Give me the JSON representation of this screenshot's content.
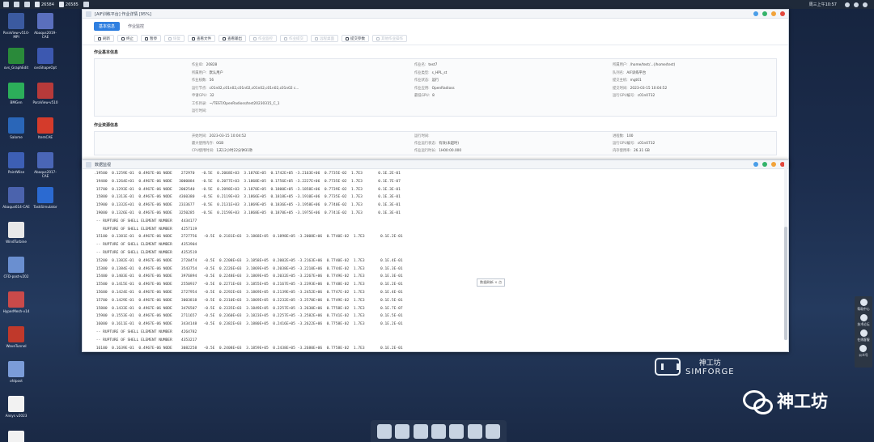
{
  "topbar": {
    "items": [
      {
        "label": "26584"
      },
      {
        "label": "26585"
      }
    ],
    "clock": "周三上午10:57"
  },
  "desktop_icons": [
    {
      "label": "ParaView-v510-MPI",
      "color": "#3b5aa0"
    },
    {
      "label": "Abaqus2019-CAE",
      "color": "#5a6fbd"
    },
    {
      "label": "ovs_GraphEdit",
      "color": "#2a8a3a"
    },
    {
      "label": "ovsShapeOpt",
      "color": "#3c58b0"
    },
    {
      "label": "BMGen",
      "color": "#2cae5a"
    },
    {
      "label": "ParaView-v510",
      "color": "#b73a3a"
    },
    {
      "label": "Salome",
      "color": "#2a66b8"
    },
    {
      "label": "ItemCAE",
      "color": "#d43b2b"
    },
    {
      "label": "PointWise",
      "color": "#3d5fb4"
    },
    {
      "label": "Abaqus2017-CAE",
      "color": "#4a66b6"
    },
    {
      "label": "Abaqus614-CAE",
      "color": "#4b63ad"
    },
    {
      "label": "TaskSimulator",
      "color": "#2b6ad1"
    },
    {
      "label": "WindTurbine",
      "color": "#e8e8e8"
    },
    {
      "label": "CFD-post-v202",
      "color": "#6a8fd0"
    },
    {
      "label": "HyperMesh-v14",
      "color": "#c94a4a"
    },
    {
      "label": "WaveTunnel",
      "color": "#c0392b"
    },
    {
      "label": "ofdpost",
      "color": "#7b9cd8"
    },
    {
      "label": "Ansys v2023",
      "color": "#f2f2f2"
    },
    {
      "label": "tunnelid",
      "color": "#f2f2f2"
    }
  ],
  "main_window": {
    "title": "[AIF训练平台] 作业详情 [95%]",
    "tabs": [
      "基本信息",
      "作业监控"
    ],
    "toolbar": [
      {
        "label": "刷新",
        "disabled": false
      },
      {
        "label": "终止",
        "disabled": false
      },
      {
        "label": "暂停",
        "disabled": false
      },
      {
        "label": "恢复",
        "disabled": true
      },
      {
        "label": "查看文件",
        "disabled": false
      },
      {
        "label": "查看输出",
        "disabled": false
      },
      {
        "label": "作业监控",
        "disabled": true
      },
      {
        "label": "作业提交",
        "disabled": true
      },
      {
        "label": "远程桌面",
        "disabled": true
      },
      {
        "label": "提交参数",
        "disabled": false
      },
      {
        "label": "其他作业操作",
        "disabled": true
      }
    ],
    "section1_title": "作业基本信息",
    "info": [
      {
        "k": "作业ID:",
        "v": "20828"
      },
      {
        "k": "所属用户:",
        "v": "默认用户"
      },
      {
        "k": "作业核数:",
        "v": "56"
      },
      {
        "k": "运行节点:",
        "v": "c01n02,c01n02,c01n02,c01n02,c01n02,c01n02 c..."
      },
      {
        "k": "申请GPU:",
        "v": "32"
      },
      {
        "k": "工作目录:",
        "v": "~/TEST/OpenRadioss/test20230315_C_1"
      },
      {
        "k": "运行时间:",
        "v": ""
      },
      {
        "k": "作业名:",
        "v": "test7"
      },
      {
        "k": "作业类型:",
        "v": "s_HPL_st"
      },
      {
        "k": "作业状态:",
        "v": "运行"
      },
      {
        "k": "作业应用:",
        "v": "OpenRadioss"
      },
      {
        "k": "最低GPU:",
        "v": "8"
      },
      {
        "k": "所属用户:",
        "v": "/home/test/...(/home/test)"
      },
      {
        "k": "队列名:",
        "v": "AIF训练平台"
      },
      {
        "k": "提交主机:",
        "v": "mgt01"
      },
      {
        "k": "提交时间:",
        "v": "2023-03-15 10:04:52"
      },
      {
        "k": "运行GPU编号:",
        "v": "c01n0732"
      }
    ],
    "section2_title": "作业资源信息",
    "info2": [
      {
        "k": "开始时间:",
        "v": "2023-03-15 10:04:52"
      },
      {
        "k": "最大使用内存:",
        "v": "0GB"
      },
      {
        "k": "CPU使用时间:",
        "v": "1天12小时22分钟31秒"
      },
      {
        "k": "运行时间:",
        "v": ""
      },
      {
        "k": "作业运行状态:",
        "v": "有效(未超时)"
      },
      {
        "k": "作业运行时长:",
        "v": "1H00:00.000"
      },
      {
        "k": "进程数:",
        "v": "100"
      },
      {
        "k": "运行GPU编号:",
        "v": "c01n0732"
      },
      {
        "k": "内存使用率:",
        "v": "26.31 GB"
      }
    ]
  },
  "log_window": {
    "title": "数据监视",
    "tooltip": "数据刷新 × 点",
    "lines": [
      ".19500  0.1259E-01  0.4967E-06 NODE    272970   -0.5E  0.2068E+03  3.1876E+05  0.1742E+05 -3.2163E+06  0.7735E-02  1.7E3       0.1E.2E-01",
      " 19400  0.1264E+01  0.4967E-06 NODE   3000084   -0.5E  0.2077E+03  3.1868E+05  0.1756E+05 -3.2227E+06  0.7735E-02  1.7E3       0.1E.7E-07",
      " 15700  0.1293E-01  0.4967E-06 NODE   2002540   -0.5E  0.2098E+03  3.1878E+05  0.1800E+05 -3.1858E+06  0.7739E-02  1.7E3       0.1E.3E-01",
      " 15800  0.1313E-01  0.4967E-06 NODE   4360380   -0.5E  0.2119E+03  3.1866E+05  0.1818E+05 -3.1910E+06  0.7735E-02  1.7E3       0.1E.3E-01",
      " 15900  0.1332E+01  0.4967E-06 NODE   2333677   -0.5E  0.2131E+03  3.1869E+05  0.1836E+05 -3.1958E+06  0.7740E-02  1.7E3       0.1E.3E-01",
      " 19000  0.1326E-01  0.4967E-06 NODE   3250285   -0.5E  0.2159E+03  3.1868E+05  0.1870E+05 -3.1975E+06  0.7741E-02  1.7E3       0.1E.3E-01",
      " -- RUPTURE OF SHELL ELEMENT NUMBER    4434177",
      "    RUPTURE OF SHELL ELEMENT NUMBER    4257119",
      " 15100  0.1381E-01  0.4967E-06 NODE    2727756   -0.5E  0.2181E+03  3.1868E+05  0.1898E+05 -3.2008E+06  0.7740E-02  1.7E3       0.1E.2E-01",
      " -- RUPTURE OF SHELL ELEMENT NUMBER    4353904",
      " -- RUPTURE OF SHELL ELEMENT NUMBER    4353519",
      " 15200  0.1382E-01  0.4967E-06 NODE    2720474   -0.5E  0.2208E+03  3.1858E+05  0.2002E+05 -3.2163E+06  0.7740E-02  1.7E3       0.1E.4E-01",
      " 15300  0.1384E-01  0.4967E-06 NODE    3543754   -0.5E  0.2226E+03  3.1869E+05  0.2038E+05 -3.2210E+06  0.7744E-02  1.7E3       0.1E.3E-01",
      " 15400  0.1403E-01  0.4967E-06 NODE    3976894   -0.5E  0.2248E+03  3.1869E+05  0.2032E+05 -3.2267E+06  0.7749E-02  1.7E3       0.1E.3E-01",
      " 15500  0.1415E-01  0.4967E-06 NODE    2550937   -0.5E  0.2271E+03  3.1855E+05  0.2167E+05 -3.2393E+06  0.7748E-02  1.7E3       0.1E.2E-01",
      " 15600  0.1424E-01  0.4967E-06 NODE    2727954   -0.5E  0.2292E+03  3.1869E+05  0.2139E+05 -3.2452E+06  0.7747E-02  1.7E3       0.1E.4E-01",
      " 15700  0.1429E-01  0.4967E-06 NODE    3003818   -0.5E  0.2310E+03  3.1869E+05  0.2232E+05 -3.2570E+06  0.7749E-02  1.7E3       0.1E.5E-01",
      " 15800  0.1433E-01  0.4967E-06 NODE    3476507   -0.5E  0.2335E+03  3.1849E+05  0.2257E+05 -3.2630E+06  0.7758E-02  1.7E3       0.1E.7E-07",
      " 15900  0.1553E-01  0.4967E-06 NODE    2711657   -0.5E  0.2360E+03  3.1823E+05  0.2257E+05 -3.2582E+06  0.7741E-02  1.7E3       0.1E.5E-01",
      " 16000  0.1611E-01  0.4967E-06 NODE    3434148   -0.5E  0.2382E+03  3.1880E+05  0.2416E+05 -3.2622E+06  0.7758E-02  1.7E3       0.1E.2E-01",
      " -- RUPTURE OF SHELL ELEMENT NUMBER    4264782",
      " -- RUPTURE OF SHELL ELEMENT NUMBER    4353217",
      " 16100  0.1639E-01  0.4967E-06 NODE    3082258   -0.5E  0.2408E+03  3.1859E+05  0.2438E+05 -3.2680E+06  0.7758E-02  1.7E3       0.1E.2E-01",
      " 16200  0.1673E-01  0.4967E-06 NODE    2714701   -0.5E  0.2434E+03  3.1867E+05  0.2468E+05 -3.2650E+06  0.7769E-02  1.7E3       0.1E.2E-01",
      " 16300  0.1614E-01  0.4967E-06 NODE   30000883   -0.5E  0.2448E+03  3.1869E+05  0.2487E+05 -3.2728E+06  0.7773E-02  1.7E3       0.1E.1E-01"
    ]
  },
  "side_panel": [
    {
      "label": "帮助中心"
    },
    {
      "label": "技术论坛"
    },
    {
      "label": "在线客服"
    },
    {
      "label": "公众号"
    }
  ],
  "logo": {
    "cn": "神工坊",
    "en": "SIMFORGE"
  },
  "wechat_label": "神工坊"
}
